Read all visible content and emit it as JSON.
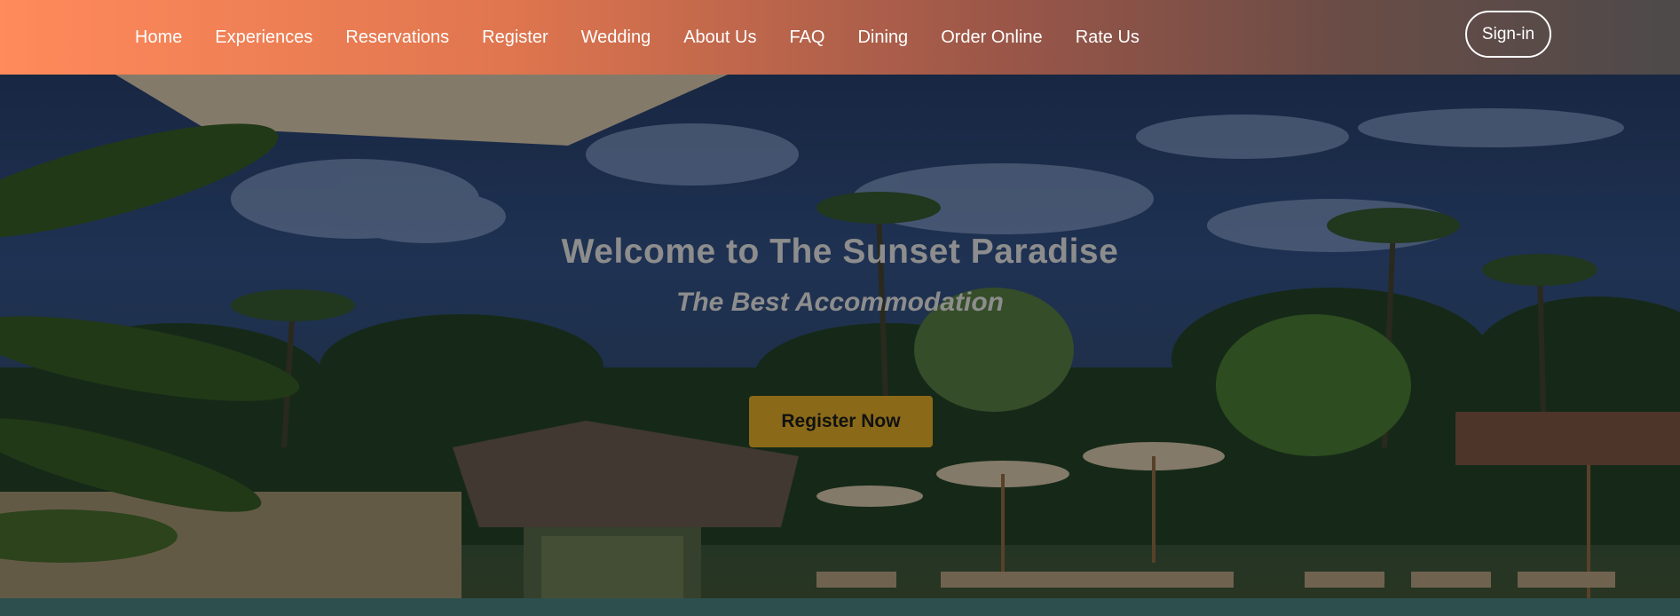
{
  "nav": {
    "links": [
      "Home",
      "Experiences",
      "Reservations",
      "Register",
      "Wedding",
      "About Us",
      "FAQ",
      "Dining",
      "Order Online",
      "Rate Us"
    ],
    "signin_label": "Sign-in"
  },
  "hero": {
    "title": "Welcome to The Sunset Paradise",
    "subtitle": "The Best Accommodation",
    "cta_label": "Register Now",
    "background_image": "tropical-resort-pool-palm-trees"
  },
  "colors": {
    "nav_gradient_start": "#ff8a5b",
    "nav_gradient_end": "#4d4a4a",
    "cta_bg": "#8a6a18",
    "hero_text": "#8d8d8d"
  }
}
